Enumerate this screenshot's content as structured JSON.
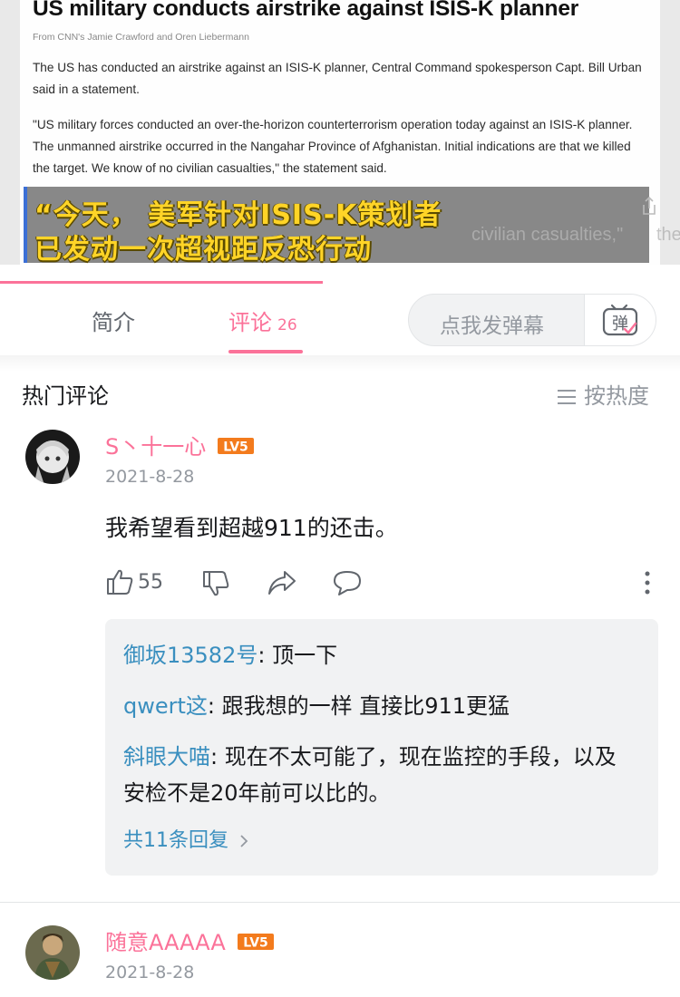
{
  "video": {
    "headline": "US military conducts airstrike against ISIS-K planner",
    "byline": "From CNN's Jamie Crawford and Oren Liebermann",
    "paragraph1": "The US has conducted an airstrike against an ISIS-K planner, Central Command spokesperson Capt. Bill Urban said in a statement.",
    "paragraph2": "\"US military forces conducted an over-the-horizon counterterrorism operation today against an ISIS-K planner. The unmanned airstrike occurred in the Nangahar Province of Afghanistan. Initial indications are that we killed the target. We know of no civilian casualties,\" the statement said.",
    "ghost_text": "civilian casualties,\"",
    "ghost_text2": "the",
    "subtitle_line1": "“今天， 美军针对ISIS-K策划者",
    "subtitle_line2": "已发动一次超视距反恐行动",
    "progress": 0.475
  },
  "tabs": {
    "intro_label": "简介",
    "comments_label": "评论",
    "comments_count": "26"
  },
  "danmaku": {
    "placeholder": "点我发弹幕",
    "button_label": "弹"
  },
  "comments_section": {
    "title": "热门评论",
    "sort_label": "按热度"
  },
  "comments": [
    {
      "username": "S丶十一心",
      "level": "LV5",
      "date": "2021-8-28",
      "text": "我希望看到超越911的还击。",
      "likes": "55",
      "replies": [
        {
          "name": "御坂13582号",
          "text": ": 顶一下"
        },
        {
          "name": "qwert这",
          "text": ": 跟我想的一样  直接比911更猛"
        },
        {
          "name": "斜眼大喵",
          "text": ": 现在不太可能了，现在监控的手段，以及安检不是20年前可以比的。"
        }
      ],
      "more_replies": "共11条回复"
    },
    {
      "username": "随意AAAAA",
      "level": "LV5",
      "date": "2021-8-28"
    }
  ],
  "colors": {
    "accent": "#fb7299",
    "reply_name": "#3a8fbf",
    "subtitle": "#ffd427",
    "level_badge": "#f37b1d"
  }
}
